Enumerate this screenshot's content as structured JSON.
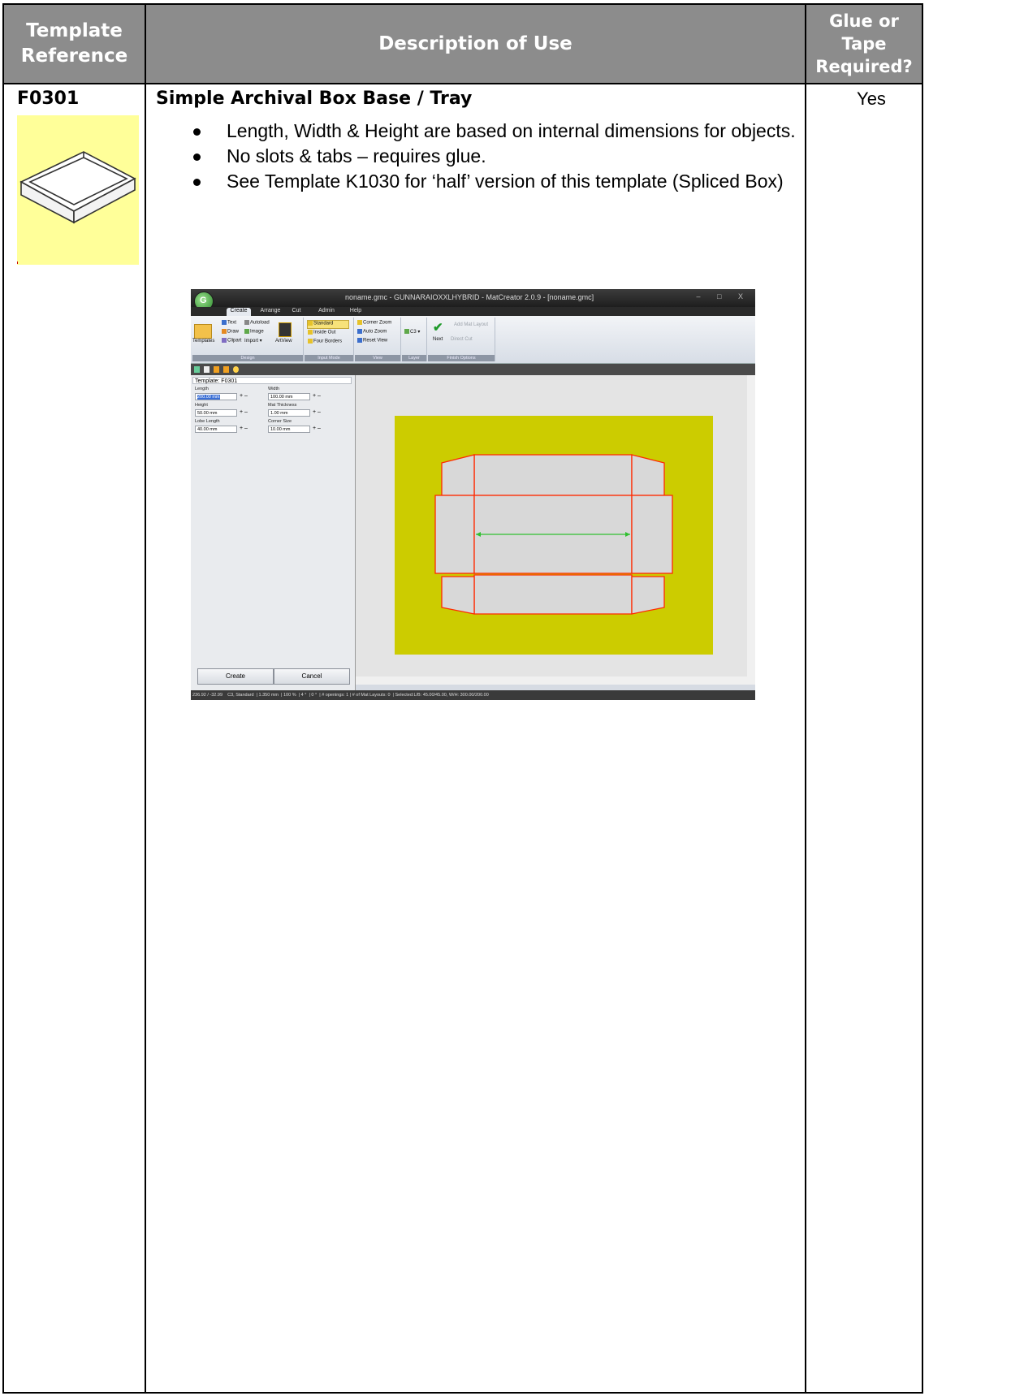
{
  "table": {
    "headers": {
      "col1_line1": "Template",
      "col1_line2": "Reference",
      "col2": "Description of Use",
      "col3_line1": "Glue or",
      "col3_line2": "Tape",
      "col3_line3": "Required?"
    },
    "row": {
      "reference": "F0301",
      "title": "Simple Archival Box Base / Tray",
      "bullets": [
        "Length, Width & Height are based on internal dimensions for objects.",
        "No slots & tabs – requires glue.",
        "See Template K1030 for ‘half’ version of this template (Spliced Box)"
      ],
      "glue_required": "Yes"
    }
  },
  "app": {
    "window_title": "noname.gmc - GUNNARAIOXXLHYBRID - MatCreator 2.0.9 - [noname.gmc]",
    "window_controls": "– □ X",
    "logo_letter": "G",
    "tabs": [
      "Create",
      "Arrange",
      "Cut",
      "Admin",
      "Help"
    ],
    "ribbon": {
      "templates": "Templates",
      "text": "Text",
      "autoload": "Autoload",
      "draw": "Draw",
      "image": "Image",
      "clipart": "Clipart",
      "import": "Import ▾",
      "artview": "ArtView",
      "design_group": "Design",
      "standard": "Standard",
      "inside_out": "Inside Out",
      "four_borders": "Four Borders",
      "input_mode_group": "Input Mode",
      "corner_zoom": "Corner Zoom",
      "auto_zoom": "Auto Zoom",
      "reset_view": "Reset View",
      "view_group": "View",
      "layer_value": "C3 ▾",
      "layer_group": "Layer",
      "next": "Next",
      "add_mat_layout": "Add Mat Layout",
      "direct_cut": "Direct Cut",
      "finish_group": "Finish Options"
    },
    "panel": {
      "template_label": "Template: F0301",
      "fields": [
        {
          "label": "Length",
          "value": "200.00 mm"
        },
        {
          "label": "Width",
          "value": "100.00 mm"
        },
        {
          "label": "Height",
          "value": "50.00 mm"
        },
        {
          "label": "Mat Thickness",
          "value": "1.00 mm"
        },
        {
          "label": "Lobe Length",
          "value": "40.00 mm"
        },
        {
          "label": "Corner Size",
          "value": "10.00 mm"
        }
      ],
      "plus_minus": "+ –",
      "create_button": "Create",
      "cancel_button": "Cancel"
    },
    "status": "236.92 / -32.99    C3, Standard  | 1.350 mm  | 100 %  | 4 °  | 0 °  | # openings: 1 | # of Mat Layouts: 0  | Selected:L/B: 45.00/45.00, W/H: 300.00/200.00",
    "colors": {
      "mat": "#cccc00",
      "cut_lines": "#ff2a00",
      "panel_fill": "#d8d8d8",
      "measure_line": "#30c030"
    }
  }
}
